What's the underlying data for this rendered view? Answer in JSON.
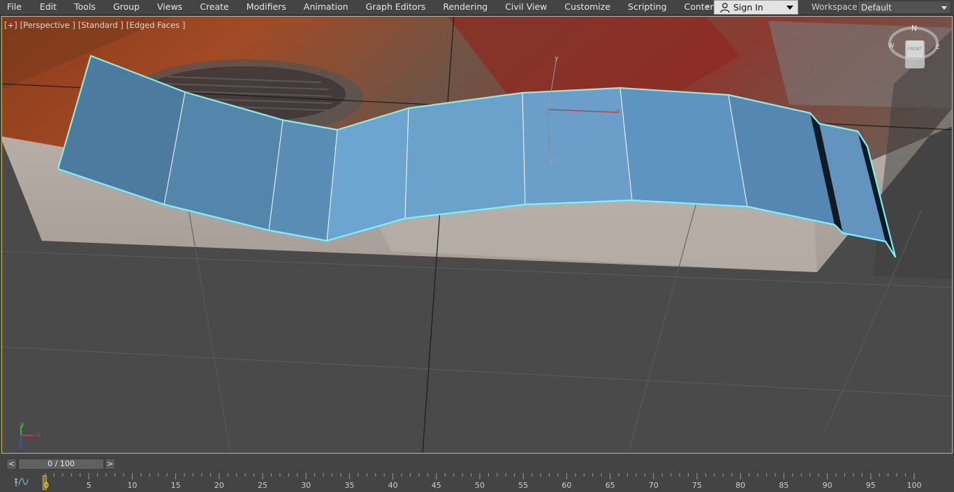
{
  "menubar": {
    "items": [
      "File",
      "Edit",
      "Tools",
      "Group",
      "Views",
      "Create",
      "Modifiers",
      "Animation",
      "Graph Editors",
      "Rendering",
      "Civil View",
      "Customize",
      "Scripting",
      "Content"
    ],
    "overflow": "»",
    "sign_in": "Sign In",
    "workspaces_label": "Workspaces:",
    "workspace_value": "Default"
  },
  "viewport": {
    "labels": [
      "[+]",
      "[Perspective ]",
      "[Standard ]",
      "[Edged Faces ]"
    ],
    "gizmo": {
      "y": "y",
      "x": "x",
      "z": "z"
    },
    "viewcube": {
      "north": "N",
      "west": "W",
      "east": "E",
      "face": "FRONT"
    },
    "axis_tripod": {
      "x": "x",
      "y": "y",
      "z": "z"
    },
    "colors": {
      "selection": "#7ff0f4",
      "ribbon": "#6a9ec6",
      "frame": "#d6b74a"
    }
  },
  "timeline": {
    "prev": "<",
    "next": ">",
    "slider_text": "0 / 100",
    "current_frame": "0",
    "tick_labels": [
      "0",
      "5",
      "10",
      "15",
      "20",
      "25",
      "30",
      "35",
      "40",
      "45",
      "50",
      "55",
      "60",
      "65",
      "70",
      "75",
      "80",
      "85",
      "90",
      "95",
      "100"
    ],
    "frame_fraction": 0
  }
}
